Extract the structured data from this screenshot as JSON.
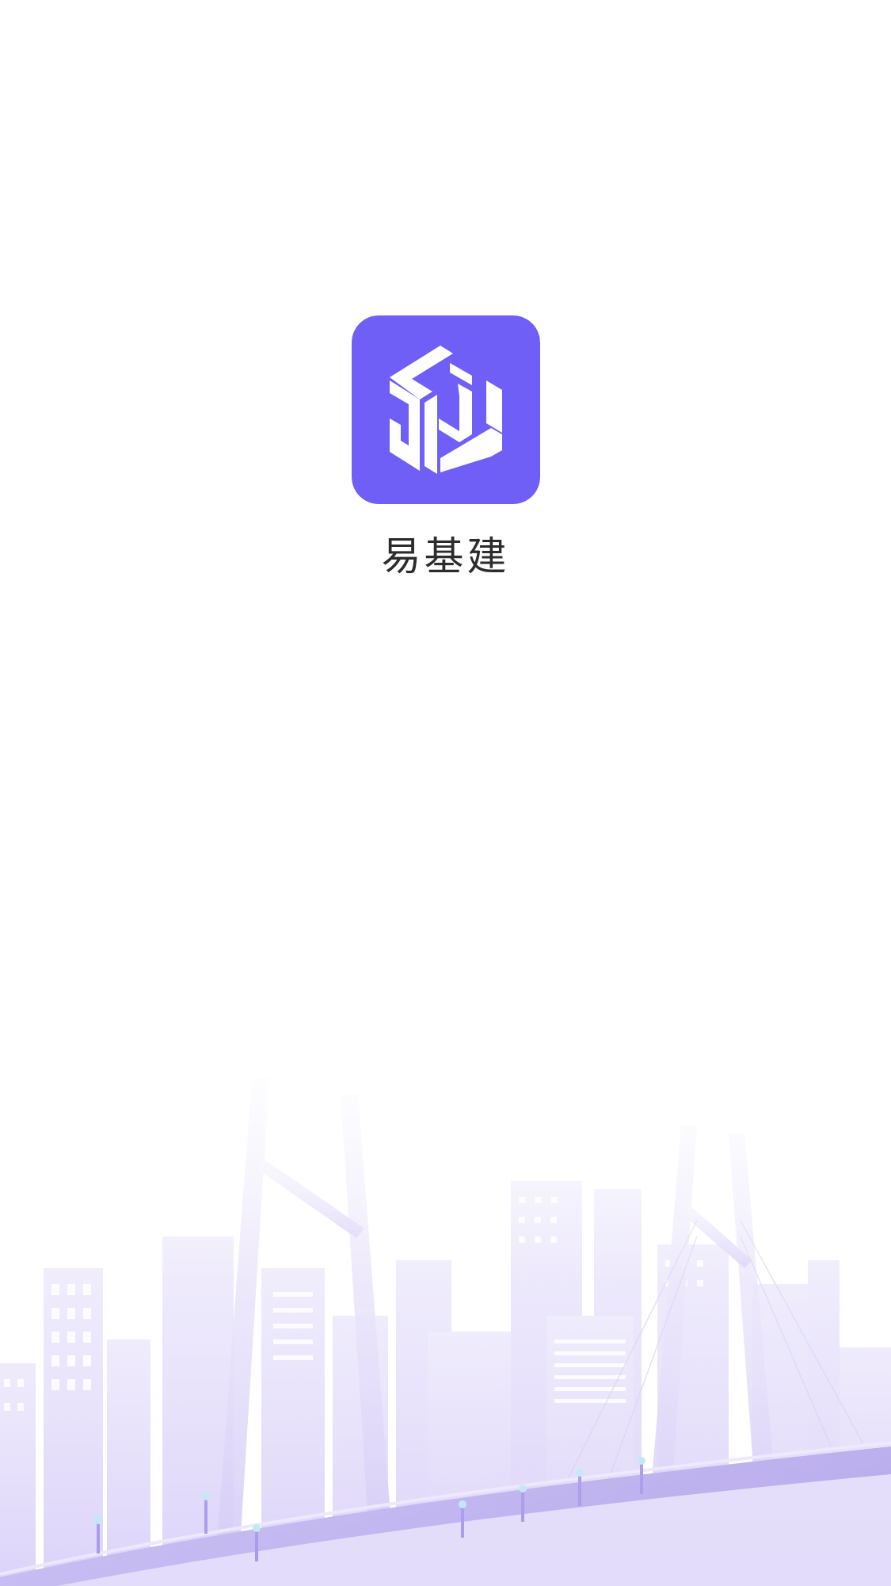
{
  "app": {
    "name": "易基建",
    "icon": "yjj-cube-logo",
    "brand_color": "#6F5FF7"
  },
  "background": {
    "illustration": "city-skyline-bridge",
    "tint_color": "#DCD3FA"
  }
}
